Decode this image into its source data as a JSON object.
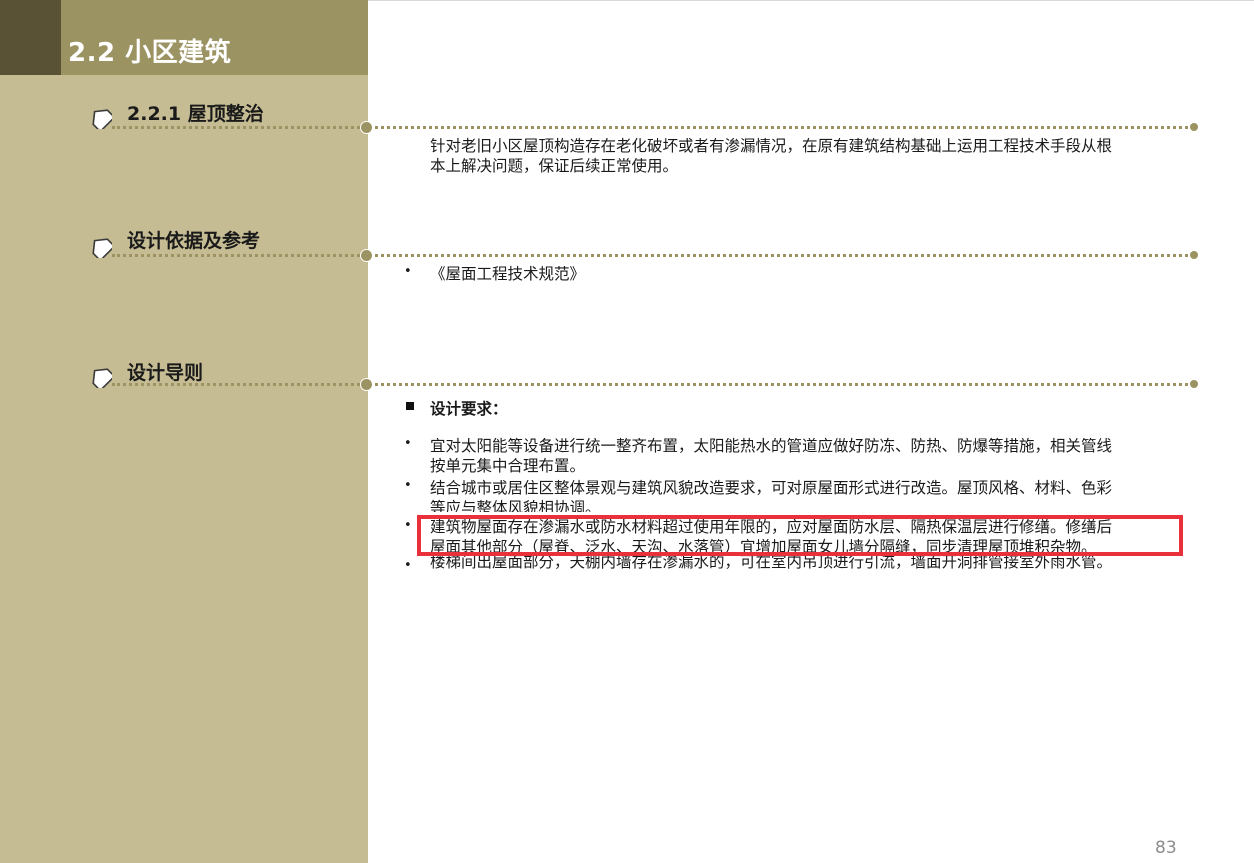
{
  "header": {
    "title": "2.2 小区建筑"
  },
  "sections": [
    {
      "title": "2.2.1 屋顶整治"
    },
    {
      "title": "设计依据及参考"
    },
    {
      "title": "设计导则"
    }
  ],
  "intro": {
    "line1": "针对老旧小区屋顶构造存在老化破坏或者有渗漏情况，在原有建筑结构基础上运用工程技术手段从根",
    "line2": "本上解决问题，保证后续正常使用。"
  },
  "references": {
    "items": [
      "《屋面工程技术规范》"
    ]
  },
  "guidelines": {
    "requirements_label": "设计要求：",
    "items": [
      {
        "line1": "宜对太阳能等设备进行统一整齐布置，太阳能热水的管道应做好防冻、防热、防爆等措施，相关管线",
        "line2": "按单元集中合理布置。"
      },
      {
        "line1": "结合城市或居住区整体景观与建筑风貌改造要求，可对原屋面形式进行改造。屋顶风格、材料、色彩",
        "line2": "等应与整体风貌相协调。"
      },
      {
        "line1": "建筑物屋面存在渗漏水或防水材料超过使用年限的，应对屋面防水层、隔热保温层进行修缮。修缮后",
        "line2": "屋面其他部分（屋脊、泛水、天沟、水落管）宜增加屋面女儿墙分隔缝，同步清理屋顶堆积杂物。"
      },
      {
        "line1": "楼梯间出屋面部分，天棚内墙存在渗漏水的，可在室内吊顶进行引流，墙面开洞排管接室外雨水管。"
      }
    ]
  },
  "highlight": {
    "color": "#e8313b"
  },
  "footer": {
    "page_number": "83"
  },
  "colors": {
    "sidebar": "#c5bc93",
    "title_bar": "#9c9363",
    "title_dark": "#5a5234",
    "accent_line": "#9c9363"
  },
  "icons": {
    "section_marker": "diamond-house-icon",
    "node": "circle-node-icon"
  }
}
